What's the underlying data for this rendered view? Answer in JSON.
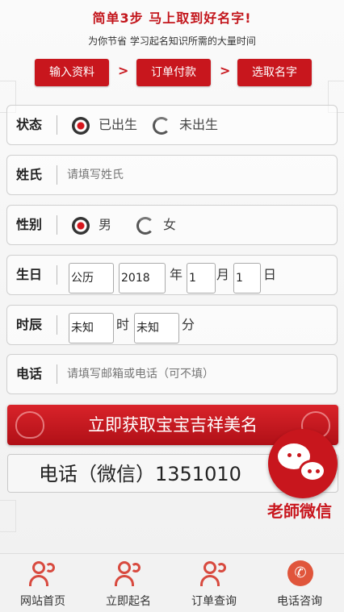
{
  "header": {
    "headline": "简单3步 马上取到好名字!",
    "subline": "为你节省 学习起名知识所需的大量时间"
  },
  "steps": [
    {
      "label": "输入资料"
    },
    {
      "label": "订单付款"
    },
    {
      "label": "选取名字"
    }
  ],
  "step_separator": ">",
  "form": {
    "status": {
      "label": "状态",
      "options": [
        {
          "label": "已出生",
          "checked": true
        },
        {
          "label": "未出生",
          "checked": false
        }
      ]
    },
    "surname": {
      "label": "姓氏",
      "placeholder": "请填写姓氏"
    },
    "gender": {
      "label": "性别",
      "options": [
        {
          "label": "男",
          "checked": true
        },
        {
          "label": "女",
          "checked": false
        }
      ]
    },
    "birthday": {
      "label": "生日",
      "calendar": "公历",
      "year": "2018",
      "year_unit": "年",
      "month": "1",
      "month_unit": "月",
      "day": "1",
      "day_unit": "日"
    },
    "birth_time": {
      "label": "时辰",
      "hour": "未知",
      "hour_unit": "时",
      "minute": "未知",
      "minute_unit": "分"
    },
    "phone": {
      "label": "电话",
      "placeholder": "请填写邮箱或电话（可不填）"
    }
  },
  "submit_label": "立即获取宝宝吉祥美名",
  "contact_phone": "电话（微信）1351010",
  "wechat_badge_label": "老師微信",
  "bottom_nav": [
    {
      "label": "网站首页",
      "icon": "user-group-icon"
    },
    {
      "label": "立即起名",
      "icon": "user-group-icon"
    },
    {
      "label": "订单查询",
      "icon": "user-group-icon"
    },
    {
      "label": "电话咨询",
      "icon": "phone-icon"
    }
  ],
  "colors": {
    "accent": "#c8161d",
    "nav_icon": "#d84a3f"
  }
}
